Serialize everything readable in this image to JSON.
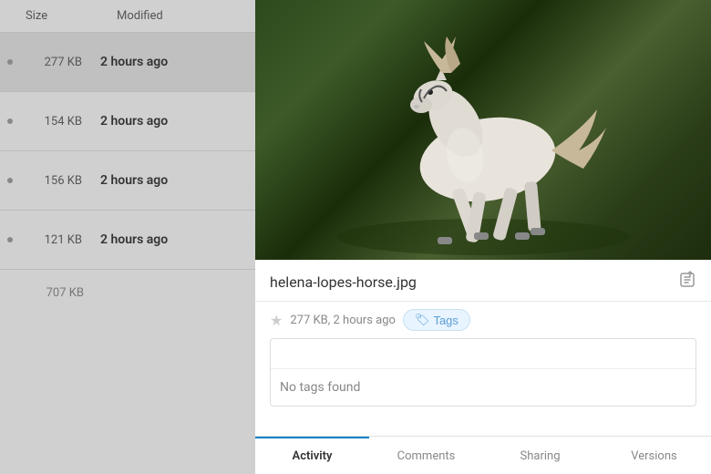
{
  "left_panel": {
    "header": {
      "size_label": "Size",
      "modified_label": "Modified"
    },
    "files": [
      {
        "size": "277 KB",
        "modified": "2 hours ago",
        "active": true
      },
      {
        "size": "154 KB",
        "modified": "2 hours ago",
        "active": false
      },
      {
        "size": "156 KB",
        "modified": "2 hours ago",
        "active": false
      },
      {
        "size": "121 KB",
        "modified": "2 hours ago",
        "active": false
      }
    ],
    "total": {
      "size": "707 KB"
    }
  },
  "right_panel": {
    "file_name": "helena-lopes-horse.jpg",
    "file_meta": "277 KB, 2 hours ago",
    "tags_button_label": "Tags",
    "tags_input_placeholder": "",
    "no_tags_text": "No tags found",
    "tabs": [
      {
        "label": "Activity",
        "active": true
      },
      {
        "label": "Comments",
        "active": false
      },
      {
        "label": "Sharing",
        "active": false
      },
      {
        "label": "Versions",
        "active": false
      }
    ]
  }
}
